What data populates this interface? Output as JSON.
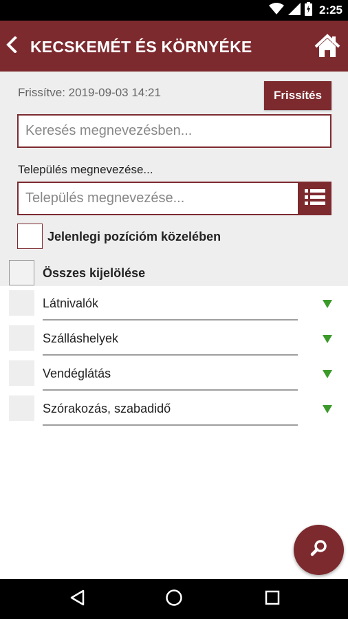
{
  "status_bar": {
    "time": "2:25"
  },
  "app_bar": {
    "title": "KECSKEMÉT ÉS KÖRNYÉKE"
  },
  "header": {
    "updated_text": "Frissítve: 2019-09-03 14:21",
    "refresh_label": "Frissítés"
  },
  "search": {
    "placeholder": "Keresés megnevezésben..."
  },
  "settlement": {
    "label": "Település megnevezése...",
    "placeholder": "Település megnevezése..."
  },
  "nearby": {
    "label": "Jelenlegi pozícióm közelében"
  },
  "select_all": {
    "label": "Összes kijelölése"
  },
  "categories": [
    {
      "label": "Látnivalók"
    },
    {
      "label": "Szálláshelyek"
    },
    {
      "label": "Vendéglátás"
    },
    {
      "label": "Szórakozás, szabadidő"
    }
  ],
  "colors": {
    "brand": "#7d2a2f",
    "arrow": "#3c9a2a",
    "content_bg": "#eeeeee"
  },
  "icons": [
    "wifi-icon",
    "signal-icon",
    "battery-icon",
    "back-icon",
    "home-icon",
    "list-icon",
    "chevron-down-icon",
    "search-icon",
    "nav-back-icon",
    "nav-home-icon",
    "nav-recents-icon"
  ]
}
